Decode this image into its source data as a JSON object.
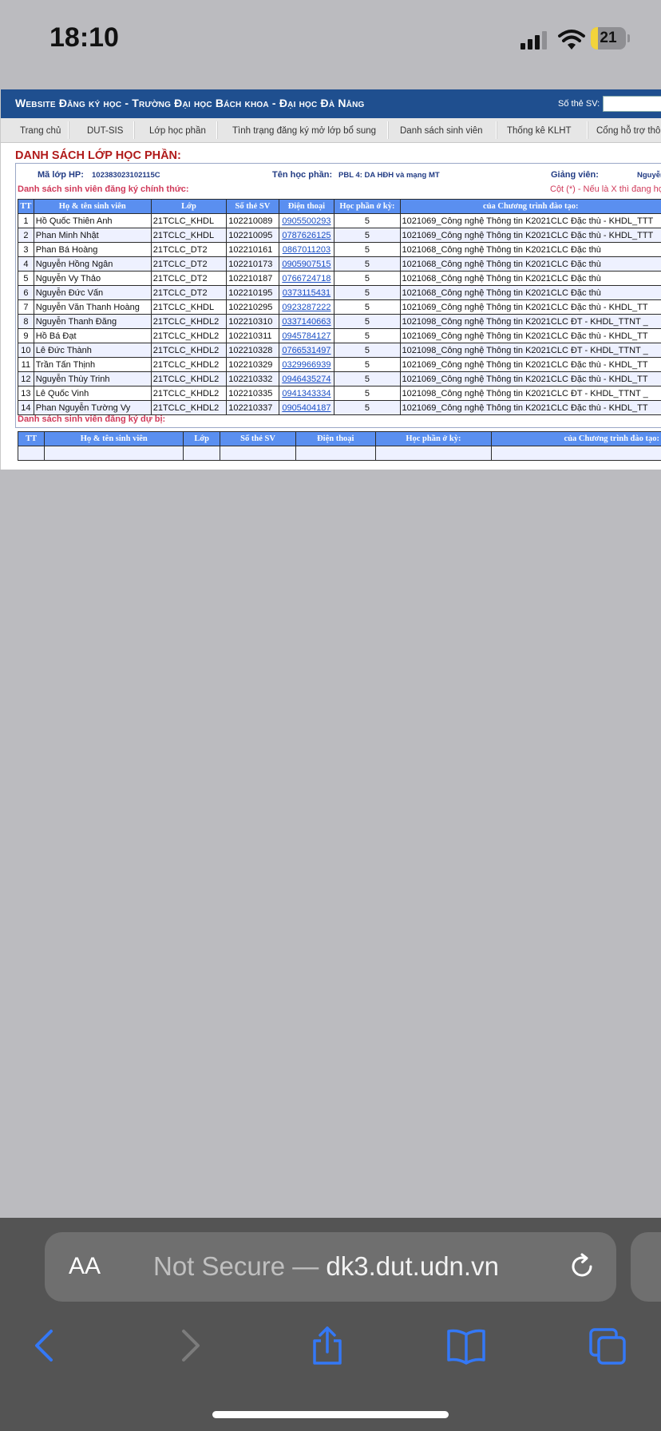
{
  "status_bar": {
    "time": "18:10",
    "battery": "21",
    "battery_fraction": 0.21
  },
  "site": {
    "title": "Website Đăng ký học - Trường Đại học Bách khoa - Đại học Đà Nẵng",
    "sv_label": "Số thẻ SV:"
  },
  "nav": {
    "items": [
      "Trang chủ",
      "DUT-SIS",
      "Lớp học phần",
      "Tình trạng đăng ký mở lớp bổ sung",
      "Danh sách sinh viên",
      "Thống kê KLHT",
      "Cổng hỗ trợ thôn"
    ]
  },
  "page": {
    "heading": "DANH SÁCH LỚP HỌC PHẦN:",
    "ma_lop_label": "Mã lớp HP:",
    "ma_lop_value": "102383023102115C",
    "ten_hp_label": "Tên học phần:",
    "ten_hp_value": "PBL 4: DA HĐH và mạng MT",
    "giang_vien_label": "Giảng viên:",
    "giang_vien_value": "Nguyễn Th",
    "official_title": "Danh sách sinh viên đăng ký chính thức:",
    "note": "Cột (*) - Nếu là X thì đang học",
    "reserve_title": "Danh sách sinh viên đăng ký dự bị:"
  },
  "table": {
    "headers": [
      "TT",
      "Họ & tên sinh viên",
      "Lớp",
      "Số thẻ SV",
      "Điện thoại",
      "Học phần ở kỳ:",
      "của Chương trình đào tạo:"
    ],
    "rows": [
      [
        "1",
        "Hồ Quốc Thiên Anh",
        "21TCLC_KHDL",
        "102210089",
        "0905500293",
        "5",
        "1021069_Công nghệ Thông tin K2021CLC Đặc thù - KHDL_TTT"
      ],
      [
        "2",
        "Phan Minh Nhật",
        "21TCLC_KHDL",
        "102210095",
        "0787626125",
        "5",
        "1021069_Công nghệ Thông tin K2021CLC Đặc thù - KHDL_TTT"
      ],
      [
        "3",
        "Phan Bá Hoàng",
        "21TCLC_DT2",
        "102210161",
        "0867011203",
        "5",
        "1021068_Công nghệ Thông tin K2021CLC Đặc thù"
      ],
      [
        "4",
        "Nguyễn Hồng Ngân",
        "21TCLC_DT2",
        "102210173",
        "0905907515",
        "5",
        "1021068_Công nghệ Thông tin K2021CLC Đặc thù"
      ],
      [
        "5",
        "Nguyễn Vy Thảo",
        "21TCLC_DT2",
        "102210187",
        "0766724718",
        "5",
        "1021068_Công nghệ Thông tin K2021CLC Đặc thù"
      ],
      [
        "6",
        "Nguyễn Đức Vấn",
        "21TCLC_DT2",
        "102210195",
        "0373115431",
        "5",
        "1021068_Công nghệ Thông tin K2021CLC Đặc thù"
      ],
      [
        "7",
        "Nguyễn Văn Thanh Hoàng",
        "21TCLC_KHDL",
        "102210295",
        "0923287222",
        "5",
        "1021069_Công nghệ Thông tin K2021CLC Đặc thù - KHDL_TT"
      ],
      [
        "8",
        "Nguyễn Thanh Đăng",
        "21TCLC_KHDL2",
        "102210310",
        "0337140663",
        "5",
        "1021098_Công nghệ Thông tin K2021CLC ĐT - KHDL_TTNT _"
      ],
      [
        "9",
        "Hồ Bá Đạt",
        "21TCLC_KHDL2",
        "102210311",
        "0945784127",
        "5",
        "1021069_Công nghệ Thông tin K2021CLC Đặc thù - KHDL_TT"
      ],
      [
        "10",
        "Lê Đức Thành",
        "21TCLC_KHDL2",
        "102210328",
        "0766531497",
        "5",
        "1021098_Công nghệ Thông tin K2021CLC ĐT - KHDL_TTNT _"
      ],
      [
        "11",
        "Trần Tấn Thịnh",
        "21TCLC_KHDL2",
        "102210329",
        "0329966939",
        "5",
        "1021069_Công nghệ Thông tin K2021CLC Đặc thù - KHDL_TT"
      ],
      [
        "12",
        "Nguyễn Thùy Trinh",
        "21TCLC_KHDL2",
        "102210332",
        "0946435274",
        "5",
        "1021069_Công nghệ Thông tin K2021CLC Đặc thù - KHDL_TT"
      ],
      [
        "13",
        "Lê Quốc Vinh",
        "21TCLC_KHDL2",
        "102210335",
        "0941343334",
        "5",
        "1021098_Công nghệ Thông tin K2021CLC ĐT - KHDL_TTNT _"
      ],
      [
        "14",
        "Phan Nguyễn Tường Vy",
        "21TCLC_KHDL2",
        "102210337",
        "0905404187",
        "5",
        "1021069_Công nghệ Thông tin K2021CLC Đặc thù - KHDL_TT"
      ]
    ]
  },
  "reserve_table": {
    "headers": [
      "TT",
      "Họ & tên sinh viên",
      "Lớp",
      "Số thẻ SV",
      "Điện thoại",
      "Học phần ở kỳ:",
      "của Chương trình đào tạo:"
    ]
  },
  "browser": {
    "aa_label": "AA",
    "url_prefix": "Not Secure —",
    "url_domain": "dk3.dut.udn.vn"
  },
  "icons": {
    "reload": "reload-icon",
    "back": "back-icon",
    "forward": "forward-icon",
    "share": "share-icon",
    "bookmarks": "bookmarks-icon",
    "tabs": "tabs-icon"
  },
  "colors": {
    "header_blue": "#1f4f8f",
    "table_header": "#5a8ff0",
    "heading_red": "#b01a1a",
    "accent_blue": "#3478f6"
  }
}
